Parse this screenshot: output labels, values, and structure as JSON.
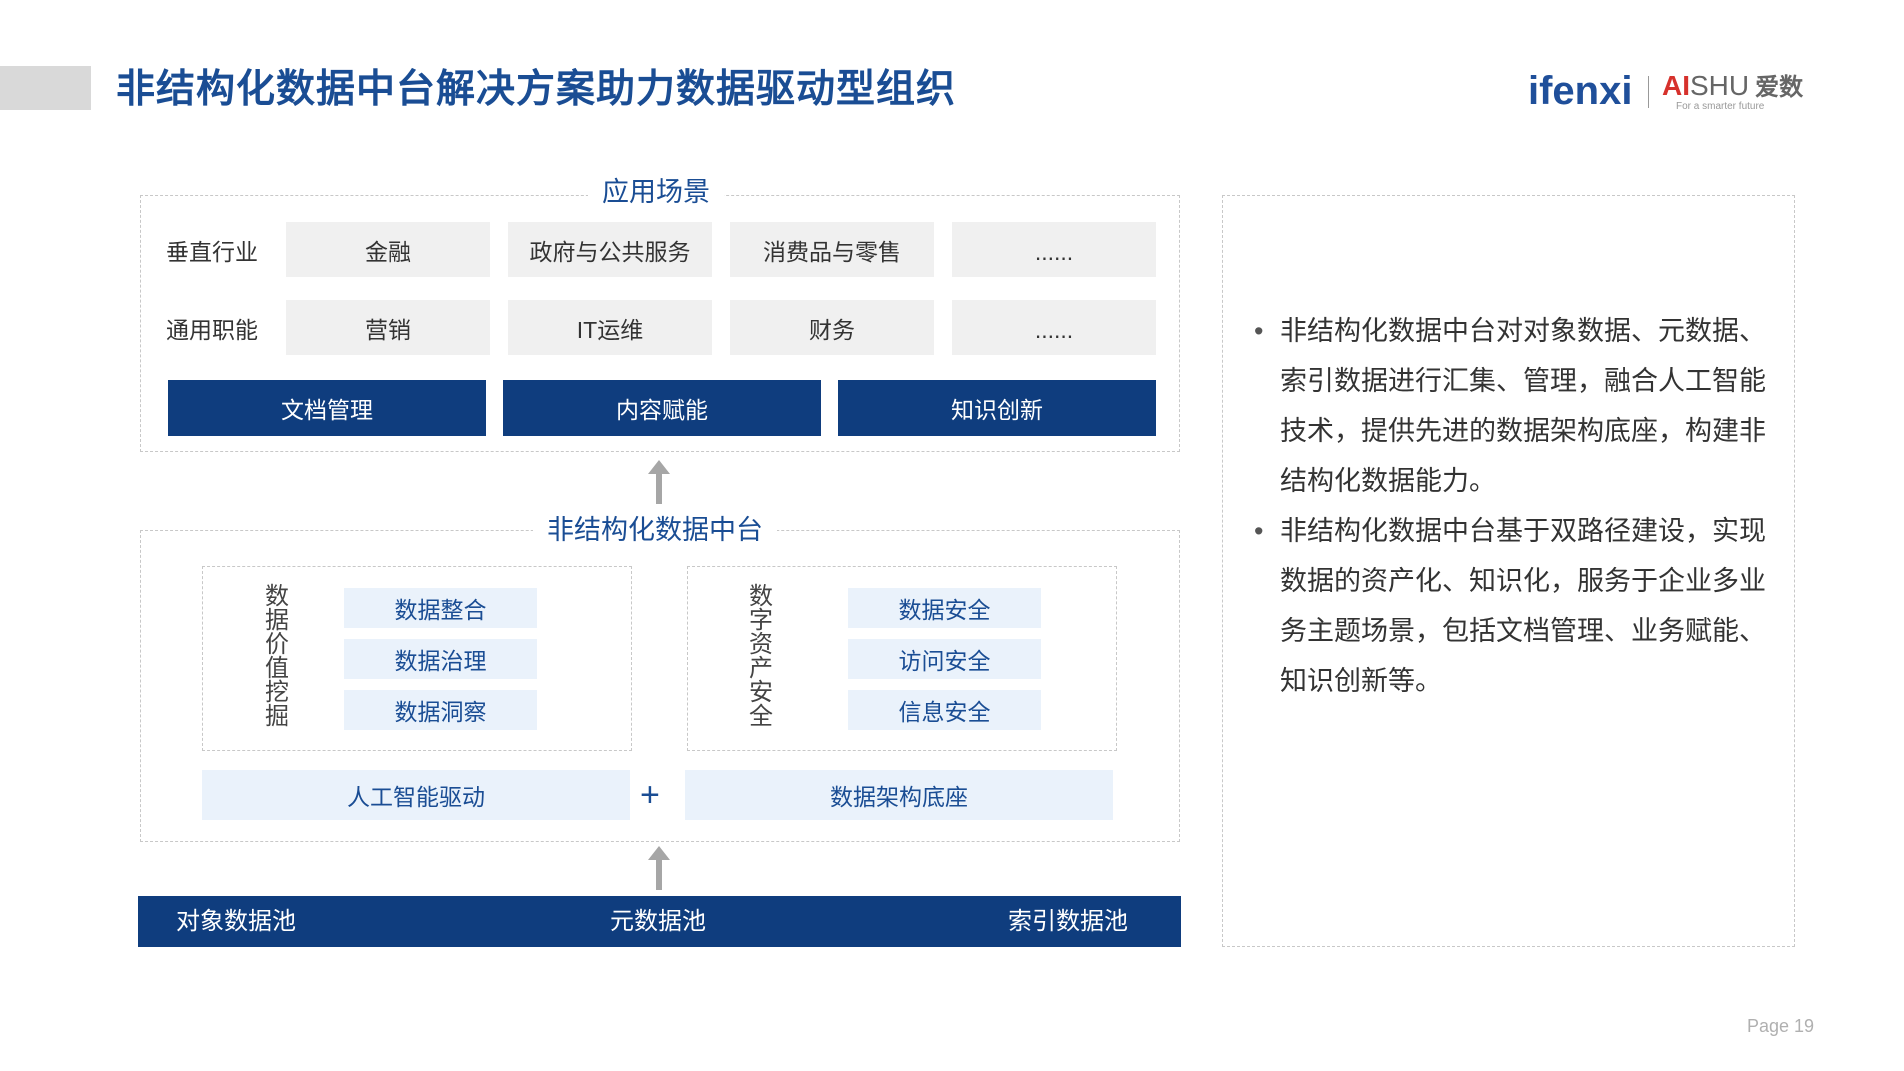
{
  "header": {
    "title": "非结构化数据中台解决方案助力数据驱动型组织",
    "logo_ifenxi": "ifenxi",
    "logo_ai": "AI",
    "logo_shu": "SHU",
    "logo_cn": "爱数",
    "logo_tagline": "For a smarter future"
  },
  "top_section": {
    "title": "应用场景",
    "row1": {
      "label": "垂直行业",
      "items": [
        "金融",
        "政府与公共服务",
        "消费品与零售",
        "......"
      ]
    },
    "row2": {
      "label": "通用职能",
      "items": [
        "营销",
        "IT运维",
        "财务",
        "......"
      ]
    },
    "blue_items": [
      "文档管理",
      "内容赋能",
      "知识创新"
    ]
  },
  "mid_section": {
    "title": "非结构化数据中台",
    "left_group": {
      "label": "数据价值挖掘",
      "items": [
        "数据整合",
        "数据治理",
        "数据洞察"
      ]
    },
    "right_group": {
      "label": "数字资产安全",
      "items": [
        "数据安全",
        "访问安全",
        "信息安全"
      ]
    },
    "bottom_left": "人工智能驱动",
    "plus": "+",
    "bottom_right": "数据架构底座"
  },
  "bottom_bar": {
    "items": [
      "对象数据池",
      "元数据池",
      "索引数据池"
    ]
  },
  "description": {
    "bullets": [
      "非结构化数据中台对对象数据、元数据、索引数据进行汇集、管理，融合人工智能技术，提供先进的数据架构底座，构建非结构化数据能力。",
      "非结构化数据中台基于双路径建设，实现数据的资产化、知识化，服务于企业多业务主题场景，包括文档管理、业务赋能、知识创新等。"
    ],
    "bullet_symbol": "•"
  },
  "footer": {
    "page": "Page  19"
  },
  "colors": {
    "brand_blue": "#0f3d7e",
    "title_blue": "#1a4d94",
    "light_blue": "#eaf2fb",
    "gray_box": "#f0f0f0",
    "logo_red": "#d6312c"
  }
}
